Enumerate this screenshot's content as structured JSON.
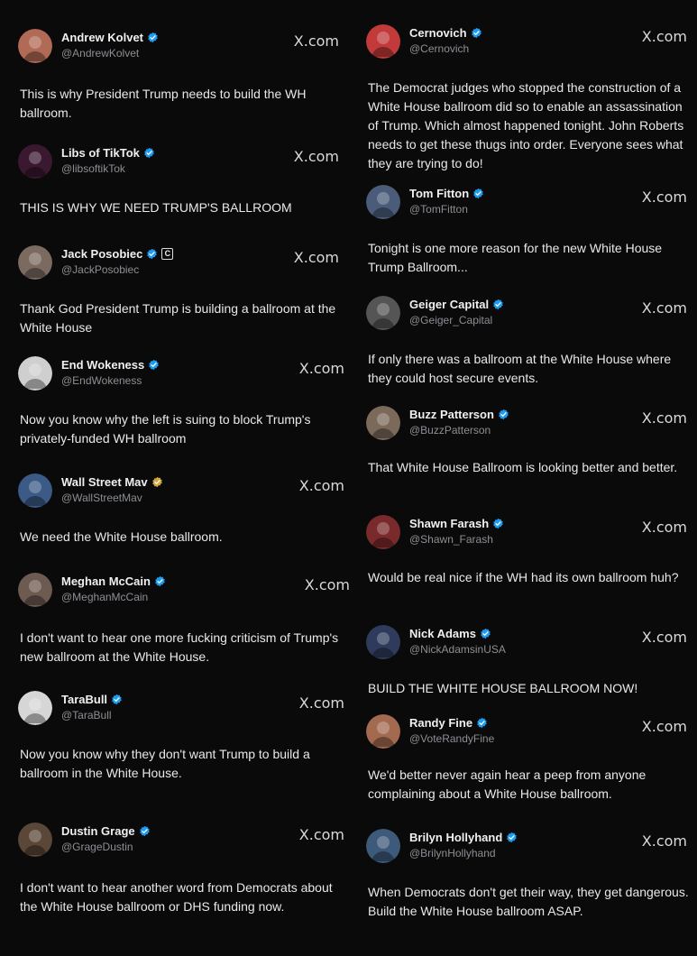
{
  "source_label": "X.com",
  "left": [
    {
      "name": "Andrew Kolvet",
      "handle": "@AndrewKolvet",
      "text": "This is why President Trump needs to build the WH ballroom."
    },
    {
      "name": "Libs of TikTok",
      "handle": "@libsoftikTok",
      "text": "THIS IS WHY WE NEED TRUMP'S BALLROOM"
    },
    {
      "name": "Jack Posobiec",
      "handle": "@JackPosobiec",
      "org_badge": "C",
      "text": "Thank God President Trump is building a ballroom at the White House"
    },
    {
      "name": "End Wokeness",
      "handle": "@EndWokeness",
      "text": "Now you know why the left is suing to block Trump's privately-funded WH ballroom"
    },
    {
      "name": "Wall Street Mav",
      "handle": "@WallStreetMav",
      "badge_color": "#d4a73b",
      "text": "We need the White House ballroom."
    },
    {
      "name": "Meghan McCain",
      "handle": "@MeghanMcCain",
      "text": "I don't want to hear one more fucking criticism of Trump's new ballroom at the White House."
    },
    {
      "name": "TaraBull",
      "handle": "@TaraBull",
      "text": "Now you know why they don't want Trump to build a ballroom in the White House."
    },
    {
      "name": "Dustin Grage",
      "handle": "@GrageDustin",
      "text": "I don't want to hear another word from Democrats about the White House ballroom or DHS funding now."
    }
  ],
  "right": [
    {
      "name": "Cernovich",
      "handle": "@Cernovich",
      "text": "The Democrat judges who stopped the construction of a White House ballroom did so to enable an assassination of Trump. Which almost happened tonight. John Roberts needs to get these thugs into order. Everyone sees what they are trying to do!"
    },
    {
      "name": "Tom Fitton",
      "handle": "@TomFitton",
      "text": "Tonight is one more reason for the new White House Trump Ballroom..."
    },
    {
      "name": "Geiger Capital",
      "handle": "@Geiger_Capital",
      "text": "If only there was a ballroom at the White House where they could host secure events."
    },
    {
      "name": "Buzz Patterson",
      "handle": "@BuzzPatterson",
      "text": "That White House Ballroom is looking better and better."
    },
    {
      "name": "Shawn Farash",
      "handle": "@Shawn_Farash",
      "text": "Would be real nice if the WH had its own ballroom huh?"
    },
    {
      "name": "Nick Adams",
      "handle": "@NickAdamsinUSA",
      "text": "BUILD THE WHITE HOUSE BALLROOM NOW!"
    },
    {
      "name": "Randy Fine",
      "handle": "@VoteRandyFine",
      "text": "We'd better never again hear a peep from anyone complaining about a White House ballroom."
    },
    {
      "name": "Brilyn Hollyhand",
      "handle": "@BrilynHollyhand",
      "text": "When Democrats don't get their way, they get dangerous. Build the White House ballroom ASAP."
    }
  ],
  "colors": {
    "verified": "#1d9bf0",
    "gold": "#d4a73b",
    "text": "#e7e9ea",
    "muted": "#8b8f94",
    "bg": "#0a0a0a"
  }
}
